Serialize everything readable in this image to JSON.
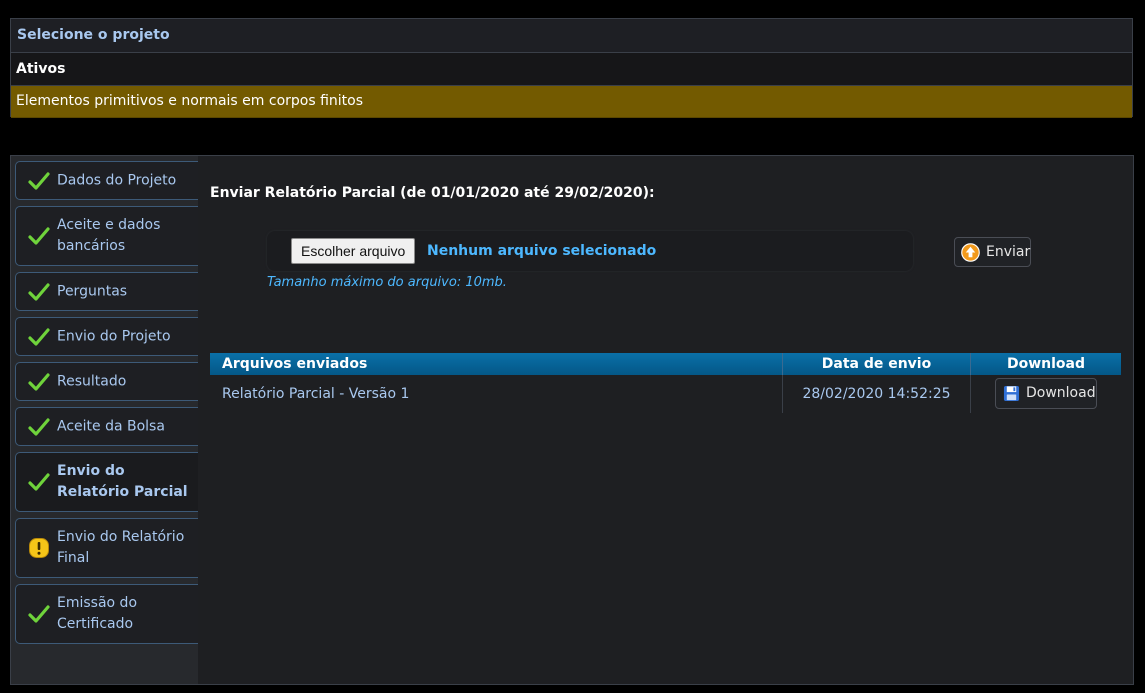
{
  "project_selector": {
    "header": "Selecione o projeto",
    "group_label": "Ativos",
    "selected_project": "Elementos primitivos e normais em corpos finitos"
  },
  "sidebar": {
    "steps": [
      {
        "label": "Dados do Projeto",
        "status": "done",
        "icon": "check-icon"
      },
      {
        "label": "Aceite e dados bancários",
        "status": "done",
        "icon": "check-icon"
      },
      {
        "label": "Perguntas",
        "status": "done",
        "icon": "check-icon"
      },
      {
        "label": "Envio do Projeto",
        "status": "done",
        "icon": "check-icon"
      },
      {
        "label": "Resultado",
        "status": "done",
        "icon": "check-icon"
      },
      {
        "label": "Aceite da Bolsa",
        "status": "done",
        "icon": "check-icon"
      },
      {
        "label": "Envio do Relatório Parcial",
        "status": "done",
        "icon": "check-icon",
        "active": true
      },
      {
        "label": "Envio do Relatório Final",
        "status": "warning",
        "icon": "warning-icon"
      },
      {
        "label": "Emissão do Certificado",
        "status": "done",
        "icon": "check-icon"
      }
    ]
  },
  "upload": {
    "title": "Enviar Relatório Parcial (de 01/01/2020 até 29/02/2020):",
    "choose_button_label": "Escolher arquivo",
    "file_status": "Nenhum arquivo selecionado",
    "max_size_note": "Tamanho máximo do arquivo: 10mb.",
    "send_button_label": "Enviar"
  },
  "files_table": {
    "headers": [
      "Arquivos enviados",
      "Data de envio",
      "Download"
    ],
    "rows": [
      {
        "name": "Relatório Parcial - Versão 1",
        "date": "28/02/2020 14:52:25",
        "download_label": "Download"
      }
    ]
  },
  "colors": {
    "accent_text": "#a9c8ef",
    "selected_project_bg": "#735a00",
    "table_header_bg": "#0a70a8",
    "link_blue": "#4db8ff",
    "check_green": "#6fd33b",
    "warning_yellow": "#f5c518"
  }
}
